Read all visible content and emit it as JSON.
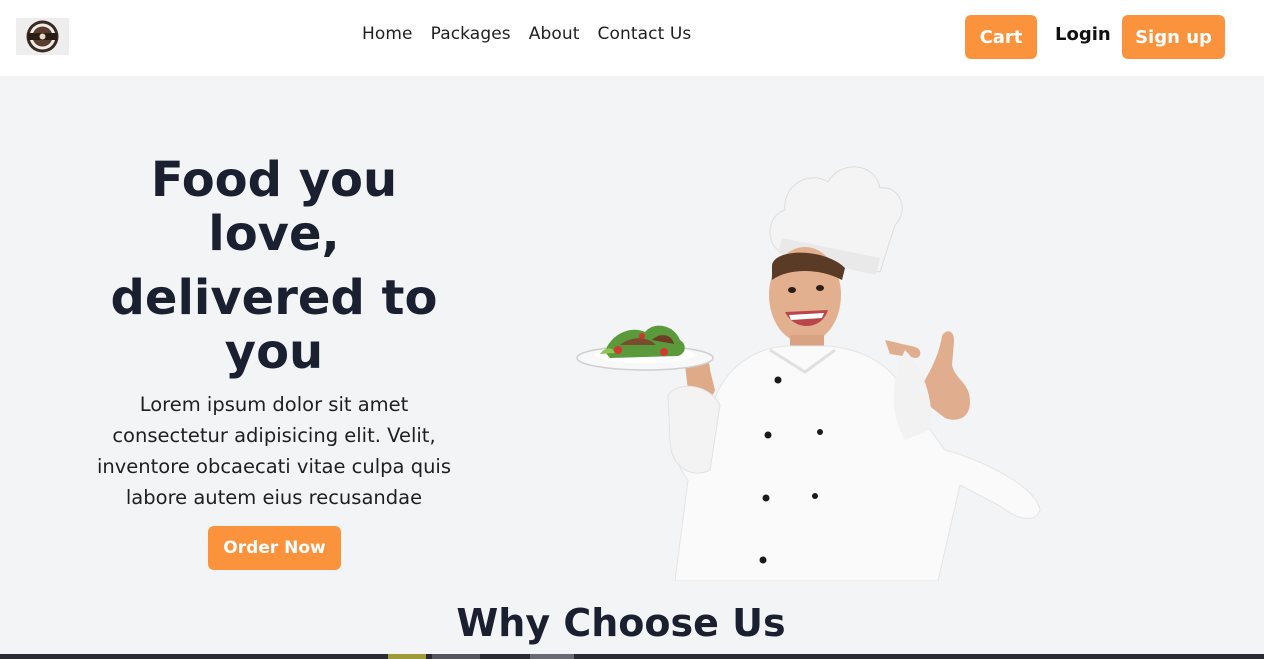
{
  "nav": {
    "links": [
      "Home",
      "Packages",
      "About",
      "Contact Us"
    ],
    "cart_label": "Cart",
    "login_label": "Login",
    "signup_label": "Sign up"
  },
  "hero": {
    "title_line1": "Food you love,",
    "title_line2": "delivered to you",
    "description": "Lorem ipsum dolor sit amet consectetur adipisicing elit. Velit, inventore obcaecati vitae culpa quis labore autem eius recusandae",
    "order_label": "Order Now"
  },
  "section": {
    "title": "Why Choose Us"
  },
  "colors": {
    "accent": "#fb923c",
    "heading": "#1a2030",
    "background": "#f3f4f6"
  },
  "icons": {
    "logo": "restaurant-logo-badge",
    "hero_image": "chef-holding-salad-plate"
  }
}
